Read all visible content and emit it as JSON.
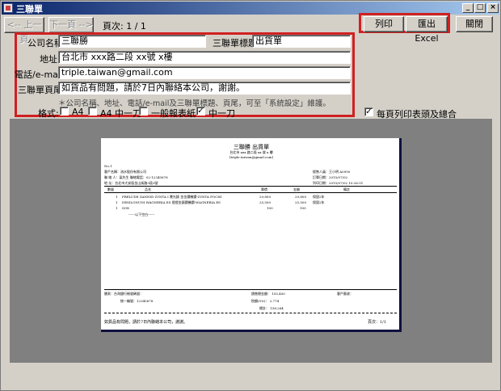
{
  "window": {
    "title": "三聯單"
  },
  "toolbar": {
    "prev_label": "<-- 上一頁",
    "next_label": "下一頁 -->",
    "page_info": "頁次: 1 / 1",
    "print_label": "列印",
    "export_label": "匯出 Excel",
    "close_label": "關閉"
  },
  "form": {
    "company_label": "公司名稱:",
    "company_value": "三聯勝",
    "sheet_title_label": "三聯單標題:",
    "sheet_title_value": "出貨單",
    "address_label": "地址:",
    "address_value": "台北市 xxx路二段 xx號 x樓",
    "phone_label": "電話/e-mail:",
    "phone_value": "triple.taiwan@gmail.com",
    "footer_label": "三聯單頁尾:",
    "footer_value": "如貨品有問題，請於7日內聯絡本公司，謝謝。",
    "hint": "＊公司名稱、地址、電話/e-mail及三聯單標題、頁尾，可至「系統設定」維護。",
    "format_label": "格式:",
    "formats": [
      {
        "label": "A4",
        "checked": false
      },
      {
        "label": "A4 中一刀",
        "checked": false
      },
      {
        "label": "一般報表紙",
        "checked": false
      },
      {
        "label": "中一刀",
        "checked": true
      }
    ],
    "print_header_label": "每頁列印表頭及總合",
    "print_header_checked": true
  },
  "report": {
    "title": "三聯勝    出貨單",
    "address": "台北市 xxx 路二段 xx 號 x 樓",
    "email": "[triple.taiwan@gmail.com]",
    "doc_no": "No.1",
    "customer_name": "客戶名稱：流水股份有限公司",
    "contact": "聯 絡 人：梁先生     聯絡電話：02-12345678",
    "address_line": "地    址：台北市大安區金山街路3段3號",
    "salesperson": "經售人員：王小明 A0950",
    "order_date": "訂單日期：2015/07/02",
    "print_date": "列印日期：2015/07/02 10:26:51",
    "columns": [
      "數量",
      "品名",
      "單價",
      "金額",
      "備註"
    ],
    "rows": [
      {
        "qty": "1",
        "name": "PRELUDE ZANNID ZYNTA I 晚光錶 金金鑽機鑽-ZYNTA FOCHI",
        "price": "29,800",
        "amount": "29,800",
        "note": "保固2年"
      },
      {
        "qty": "1",
        "name": "DESILONUNI WAGNERIA ES 燈燈金錶鑽機鑽-WAGNERIA ES",
        "price": "25,500",
        "amount": "25,500",
        "note": "保固2年"
      },
      {
        "qty": "1",
        "name": "SOX",
        "price": "100",
        "amount": "100",
        "note": ""
      }
    ],
    "blank_note": "------以下空白------",
    "remit_label": "匯款：台灣銀行帳號碼號：",
    "tax_id": "統一編號：12345678",
    "subtotal": "銷售總金額：         155,400",
    "tax": "稅額(5%)：             2,774",
    "total": "總計：             158,264",
    "signature": "客戶簽收：",
    "footer": "如貨品有問題，請於7日內聯絡本公司，謝謝。",
    "page": "頁次：1/1"
  }
}
